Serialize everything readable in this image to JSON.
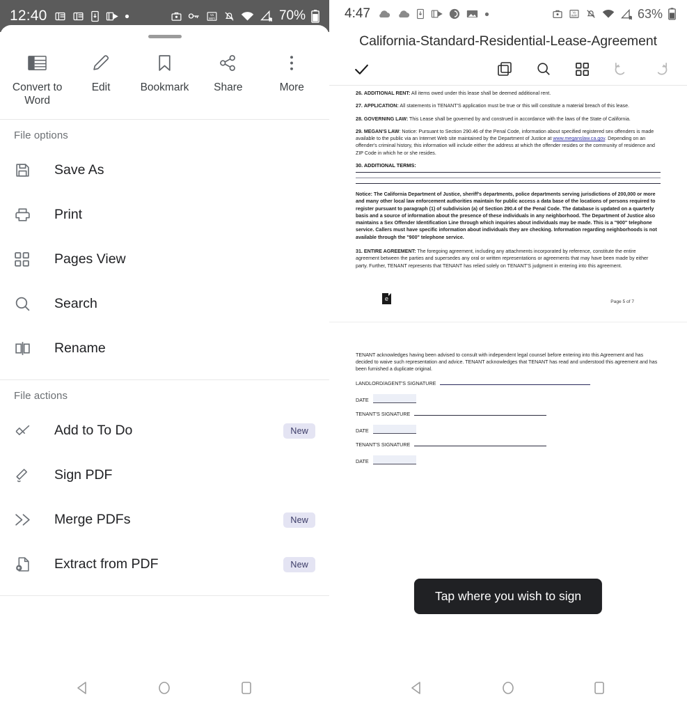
{
  "left_phone": {
    "status_bar": {
      "time": "12:40",
      "battery_percent": "70%",
      "icons": [
        "office-lens-icon",
        "office-lens-icon-2",
        "download-icon",
        "outlook-icon",
        "dot-icon"
      ],
      "right_icons": [
        "briefcase-icon",
        "vpn-key-icon",
        "volte-wifi-icon",
        "notifications-off-icon",
        "wifi-icon",
        "signal-roaming-icon",
        "battery-icon"
      ]
    },
    "quick_actions": [
      {
        "id": "convert-to-word",
        "label": "Convert to Word",
        "icon": "word-doc-icon"
      },
      {
        "id": "edit",
        "label": "Edit",
        "icon": "pencil-icon"
      },
      {
        "id": "bookmark",
        "label": "Bookmark",
        "icon": "bookmark-icon"
      },
      {
        "id": "share",
        "label": "Share",
        "icon": "share-nodes-icon"
      },
      {
        "id": "more",
        "label": "More",
        "icon": "more-vertical-icon"
      }
    ],
    "sections": [
      {
        "title": "File options",
        "items": [
          {
            "id": "save-as",
            "label": "Save As",
            "icon": "floppy-save-icon",
            "badge": ""
          },
          {
            "id": "print",
            "label": "Print",
            "icon": "printer-icon",
            "badge": ""
          },
          {
            "id": "pages-view",
            "label": "Pages View",
            "icon": "grid-pages-icon",
            "badge": ""
          },
          {
            "id": "search",
            "label": "Search",
            "icon": "search-icon",
            "badge": ""
          },
          {
            "id": "rename",
            "label": "Rename",
            "icon": "rename-icon",
            "badge": ""
          }
        ]
      },
      {
        "title": "File actions",
        "items": [
          {
            "id": "add-to-to-do",
            "label": "Add to To Do",
            "icon": "check-pen-icon",
            "badge": "New"
          },
          {
            "id": "sign-pdf",
            "label": "Sign PDF",
            "icon": "signature-pen-icon",
            "badge": ""
          },
          {
            "id": "merge-pdfs",
            "label": "Merge PDFs",
            "icon": "double-chevron-right-icon",
            "badge": "New"
          },
          {
            "id": "extract-from-pdf",
            "label": "Extract from PDF",
            "icon": "extract-file-icon",
            "badge": "New"
          }
        ]
      }
    ],
    "nav_bar": {
      "back": "back-triangle-icon",
      "home": "home-circle-icon",
      "recents": "recents-square-icon"
    }
  },
  "right_phone": {
    "status_bar": {
      "time": "4:47",
      "battery_percent": "63%",
      "icons": [
        "cloud-icon",
        "cloud-icon-2",
        "download-icon",
        "outlook-icon",
        "sync-icon",
        "photo-icon",
        "dot-icon"
      ],
      "right_icons": [
        "briefcase-icon",
        "volte-wifi-icon",
        "notifications-off-icon",
        "wifi-icon",
        "signal-roaming-icon",
        "battery-icon"
      ]
    },
    "document_title": "California-Standard-Residential-Lease-Agreement",
    "toolbar": {
      "done": "check-icon",
      "actions": [
        "copy-icon",
        "search-icon",
        "pages-grid-icon",
        "undo-icon",
        "redo-icon"
      ]
    },
    "document": {
      "clauses": [
        {
          "number": "26.",
          "heading": "ADDITIONAL RENT:",
          "body": " All items owed under this lease shall be deemed additional rent."
        },
        {
          "number": "27.",
          "heading": "APPLICATION:",
          "body": " All statements in TENANT'S application must be true or this will constitute a material breach of this lease."
        },
        {
          "number": "28.",
          "heading": "GOVERNING LAW:",
          "body": " This Lease shall be governed by and construed in accordance with the laws of the State of California."
        }
      ],
      "megans_law": {
        "number": "29.",
        "heading": "MEGAN'S LAW",
        "part1": ": Notice: Pursuant to Section 290.46 of the Penal Code, information about specified registered sex offenders is made available to the public via an Internet Web site maintained by the Department of Justice at ",
        "link": "www.meganslaw.ca.gov",
        "part2": ". Depending on an offender's criminal history, this information will include either the address at which the offender resides or the community of residence and ZIP Code in which he or she resides."
      },
      "additional_terms_heading": "30. ADDITIONAL TERMS:",
      "notice": "Notice: The California Department of Justice, sheriff's departments, police departments serving jurisdictions of 200,000 or more and many other local law enforcement authorities maintain for public access a data base of the locations of persons required to register pursuant to paragraph (1) of subdivision (a) of Section 290.4 of the Penal Code. The database is updated on a quarterly basis and a source of information about the presence of these individuals in any neighborhood. The Department of Justice also maintains a Sex Offender Identification Line through which inquiries about individuals may be made. This is a \"900\" telephone service. Callers must have specific information about individuals they are checking. Information regarding neighborhoods is not available through the \"900\" telephone service.",
      "entire_agreement": {
        "number": "31.",
        "heading": "ENTIRE AGREEMENT:",
        "body": " The foregoing agreement, including any attachments incorporated by reference, constitute the entire agreement between the parties and supersedes any oral or written representations or agreements that may have been made by either party. Further, TENANT represents that TENANT has relied solely on TENANT'S judgment in entering into this agreement."
      },
      "page_footer": "Page 5 of 7",
      "acknowledgement": "TENANT acknowledges having been advised to consult with independent legal counsel before entering into this Agreement and has decided to waive such representation and advice. TENANT acknowledges that TENANT has read and understood this agreement and has been furnished a duplicate original.",
      "signature_fields": [
        {
          "label": "LANDLORD/AGENT'S SIGNATURE",
          "type": "signature",
          "highlighted": true
        },
        {
          "label": "DATE",
          "type": "date",
          "highlighted": false
        },
        {
          "label": "TENANT'S SIGNATURE",
          "type": "signature",
          "highlighted": false
        },
        {
          "label": "DATE",
          "type": "date",
          "highlighted": false
        },
        {
          "label": "TENANT'S SIGNATURE",
          "type": "signature",
          "highlighted": false
        },
        {
          "label": "DATE",
          "type": "date",
          "highlighted": false
        }
      ]
    },
    "toast": "Tap where you wish to sign",
    "nav_bar": {
      "back": "back-triangle-icon",
      "home": "home-circle-icon",
      "recents": "recents-square-icon"
    }
  },
  "colors": {
    "status_bar_left_bg": "#5b5b5b",
    "badge_bg": "#e4e4f3",
    "badge_text": "#3a3a66",
    "toast_bg": "#202124",
    "doc_link": "#2f2fa2",
    "signature_highlight": "#262659"
  }
}
